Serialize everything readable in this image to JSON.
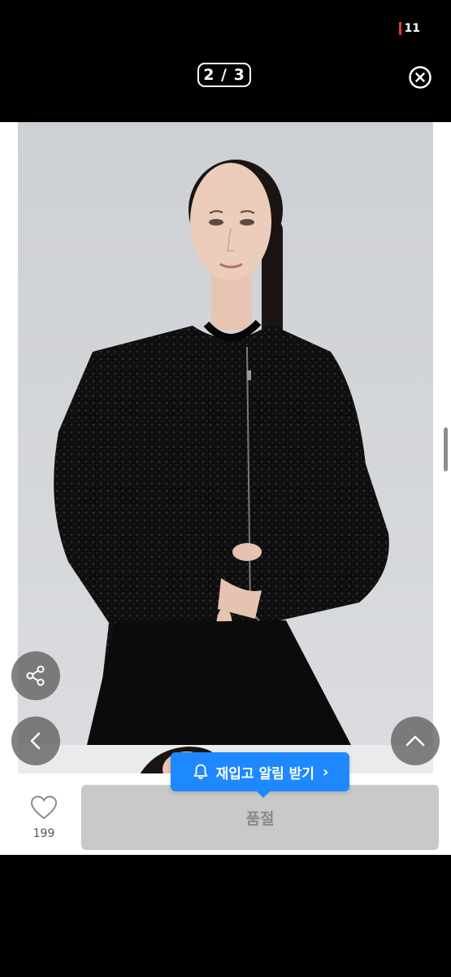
{
  "status_bar": {
    "battery_level": "11",
    "battery_color": "#e53935"
  },
  "header": {
    "page_counter": "2 / 3",
    "close_icon": "close-circle-icon"
  },
  "product_image": {
    "description_icon": "model-photo"
  },
  "actions": {
    "share_icon": "share-icon",
    "prev_icon": "chevron-left-icon",
    "top_icon": "chevron-up-icon"
  },
  "bottom_bar": {
    "like_count": "199",
    "sold_out_label": "품절",
    "restock_label": "재입고 알림 받기",
    "restock_color": "#1e88ff"
  }
}
